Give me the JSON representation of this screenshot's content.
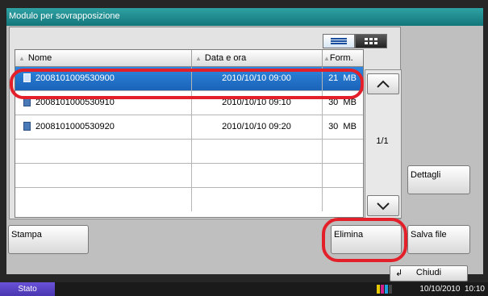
{
  "window": {
    "title": "Modulo per sovrapposizione"
  },
  "table": {
    "headers": {
      "name": "Nome",
      "datetime": "Data e ora",
      "size": "Form."
    },
    "rows": [
      {
        "name": "2008101009530900",
        "datetime": "2010/10/10 09:00",
        "size": "21  MB",
        "selected": true
      },
      {
        "name": "2008101000530910",
        "datetime": "2010/10/10 09:10",
        "size": "30  MB",
        "selected": false
      },
      {
        "name": "2008101000530920",
        "datetime": "2010/10/10 09:20",
        "size": "30  MB",
        "selected": false
      },
      {
        "name": "",
        "datetime": "",
        "size": "",
        "selected": false
      },
      {
        "name": "",
        "datetime": "",
        "size": "",
        "selected": false
      },
      {
        "name": "",
        "datetime": "",
        "size": "",
        "selected": false
      }
    ]
  },
  "pager": {
    "page": "1/1"
  },
  "buttons": {
    "details": "Dettagli",
    "print": "Stampa",
    "delete": "Elimina",
    "save_file": "Salva file",
    "close": "Chiudi"
  },
  "status_bar": {
    "label": "Stato",
    "datetime": "10/10/2010  10:10"
  },
  "colors": {
    "title_bar": "#2fa2a4",
    "selection": "#1a63b8",
    "highlight_ring": "#e3202a",
    "status_label": "#5a44c8"
  },
  "icons": {
    "view_list": "list-view-icon",
    "view_thumbnails": "thumbnail-view-icon",
    "file": "document-icon",
    "up": "chevron-up-icon",
    "down": "chevron-down-icon",
    "return": "return-arrow-icon",
    "device": "device-status-icon"
  }
}
